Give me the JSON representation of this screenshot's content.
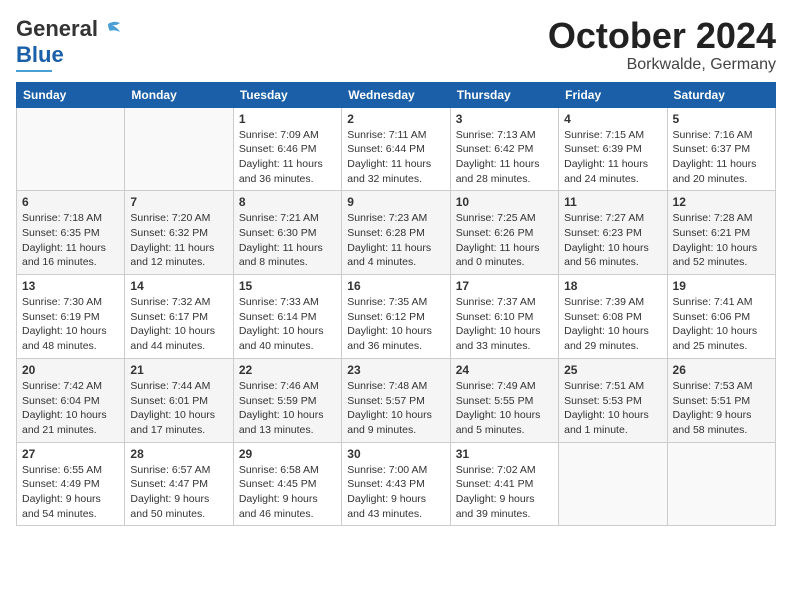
{
  "header": {
    "logo_line1": "General",
    "logo_line2": "Blue",
    "title": "October 2024",
    "subtitle": "Borkwalde, Germany"
  },
  "columns": [
    "Sunday",
    "Monday",
    "Tuesday",
    "Wednesday",
    "Thursday",
    "Friday",
    "Saturday"
  ],
  "weeks": [
    [
      {
        "day": "",
        "content": ""
      },
      {
        "day": "",
        "content": ""
      },
      {
        "day": "1",
        "content": "Sunrise: 7:09 AM\nSunset: 6:46 PM\nDaylight: 11 hours and 36 minutes."
      },
      {
        "day": "2",
        "content": "Sunrise: 7:11 AM\nSunset: 6:44 PM\nDaylight: 11 hours and 32 minutes."
      },
      {
        "day": "3",
        "content": "Sunrise: 7:13 AM\nSunset: 6:42 PM\nDaylight: 11 hours and 28 minutes."
      },
      {
        "day": "4",
        "content": "Sunrise: 7:15 AM\nSunset: 6:39 PM\nDaylight: 11 hours and 24 minutes."
      },
      {
        "day": "5",
        "content": "Sunrise: 7:16 AM\nSunset: 6:37 PM\nDaylight: 11 hours and 20 minutes."
      }
    ],
    [
      {
        "day": "6",
        "content": "Sunrise: 7:18 AM\nSunset: 6:35 PM\nDaylight: 11 hours and 16 minutes."
      },
      {
        "day": "7",
        "content": "Sunrise: 7:20 AM\nSunset: 6:32 PM\nDaylight: 11 hours and 12 minutes."
      },
      {
        "day": "8",
        "content": "Sunrise: 7:21 AM\nSunset: 6:30 PM\nDaylight: 11 hours and 8 minutes."
      },
      {
        "day": "9",
        "content": "Sunrise: 7:23 AM\nSunset: 6:28 PM\nDaylight: 11 hours and 4 minutes."
      },
      {
        "day": "10",
        "content": "Sunrise: 7:25 AM\nSunset: 6:26 PM\nDaylight: 11 hours and 0 minutes."
      },
      {
        "day": "11",
        "content": "Sunrise: 7:27 AM\nSunset: 6:23 PM\nDaylight: 10 hours and 56 minutes."
      },
      {
        "day": "12",
        "content": "Sunrise: 7:28 AM\nSunset: 6:21 PM\nDaylight: 10 hours and 52 minutes."
      }
    ],
    [
      {
        "day": "13",
        "content": "Sunrise: 7:30 AM\nSunset: 6:19 PM\nDaylight: 10 hours and 48 minutes."
      },
      {
        "day": "14",
        "content": "Sunrise: 7:32 AM\nSunset: 6:17 PM\nDaylight: 10 hours and 44 minutes."
      },
      {
        "day": "15",
        "content": "Sunrise: 7:33 AM\nSunset: 6:14 PM\nDaylight: 10 hours and 40 minutes."
      },
      {
        "day": "16",
        "content": "Sunrise: 7:35 AM\nSunset: 6:12 PM\nDaylight: 10 hours and 36 minutes."
      },
      {
        "day": "17",
        "content": "Sunrise: 7:37 AM\nSunset: 6:10 PM\nDaylight: 10 hours and 33 minutes."
      },
      {
        "day": "18",
        "content": "Sunrise: 7:39 AM\nSunset: 6:08 PM\nDaylight: 10 hours and 29 minutes."
      },
      {
        "day": "19",
        "content": "Sunrise: 7:41 AM\nSunset: 6:06 PM\nDaylight: 10 hours and 25 minutes."
      }
    ],
    [
      {
        "day": "20",
        "content": "Sunrise: 7:42 AM\nSunset: 6:04 PM\nDaylight: 10 hours and 21 minutes."
      },
      {
        "day": "21",
        "content": "Sunrise: 7:44 AM\nSunset: 6:01 PM\nDaylight: 10 hours and 17 minutes."
      },
      {
        "day": "22",
        "content": "Sunrise: 7:46 AM\nSunset: 5:59 PM\nDaylight: 10 hours and 13 minutes."
      },
      {
        "day": "23",
        "content": "Sunrise: 7:48 AM\nSunset: 5:57 PM\nDaylight: 10 hours and 9 minutes."
      },
      {
        "day": "24",
        "content": "Sunrise: 7:49 AM\nSunset: 5:55 PM\nDaylight: 10 hours and 5 minutes."
      },
      {
        "day": "25",
        "content": "Sunrise: 7:51 AM\nSunset: 5:53 PM\nDaylight: 10 hours and 1 minute."
      },
      {
        "day": "26",
        "content": "Sunrise: 7:53 AM\nSunset: 5:51 PM\nDaylight: 9 hours and 58 minutes."
      }
    ],
    [
      {
        "day": "27",
        "content": "Sunrise: 6:55 AM\nSunset: 4:49 PM\nDaylight: 9 hours and 54 minutes."
      },
      {
        "day": "28",
        "content": "Sunrise: 6:57 AM\nSunset: 4:47 PM\nDaylight: 9 hours and 50 minutes."
      },
      {
        "day": "29",
        "content": "Sunrise: 6:58 AM\nSunset: 4:45 PM\nDaylight: 9 hours and 46 minutes."
      },
      {
        "day": "30",
        "content": "Sunrise: 7:00 AM\nSunset: 4:43 PM\nDaylight: 9 hours and 43 minutes."
      },
      {
        "day": "31",
        "content": "Sunrise: 7:02 AM\nSunset: 4:41 PM\nDaylight: 9 hours and 39 minutes."
      },
      {
        "day": "",
        "content": ""
      },
      {
        "day": "",
        "content": ""
      }
    ]
  ]
}
